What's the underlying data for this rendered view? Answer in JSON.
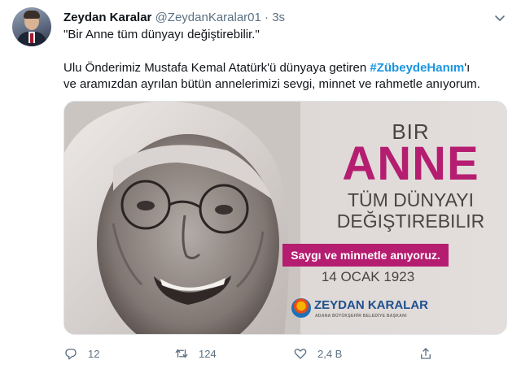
{
  "tweet": {
    "author_name": "Zeydan Karalar",
    "author_handle": "@ZeydanKaralar01",
    "separator": "·",
    "time": "3s",
    "line_1": "\"Bir Anne tüm dünyayı değiştirebilir.\"",
    "line_2_before": "Ulu Önderimiz Mustafa Kemal Atatürk'ü dünyaya getiren ",
    "hashtag": "#ZübeydeHanım",
    "line_2_after": "'ı",
    "line_3": "ve aramızdan ayrılan bütün annelerimizi sevgi, minnet ve rahmetle anıyorum."
  },
  "media": {
    "heading_small": "BIR",
    "heading_big": "ANNE",
    "line_1": "TÜM DÜNYAYI",
    "line_2": "DEĞIŞTIREBILIR",
    "badge": "Saygı ve minnetle anıyoruz.",
    "date": "14 OCAK 1923",
    "org_name": "ZEYDAN KARALAR",
    "org_subtitle": "ADANA BÜYÜKŞEHİR BELEDİYE BAŞKANI"
  },
  "actions": {
    "reply_count": "12",
    "retweet_count": "124",
    "like_count": "2,4 B"
  },
  "icons": {
    "more": "chevron-down-icon",
    "reply": "reply-icon",
    "retweet": "retweet-icon",
    "like": "heart-icon",
    "share": "share-icon"
  },
  "colors": {
    "hashtag": "#1b95e0",
    "accent_magenta": "#b51d70",
    "muted_text": "#5b7083"
  }
}
